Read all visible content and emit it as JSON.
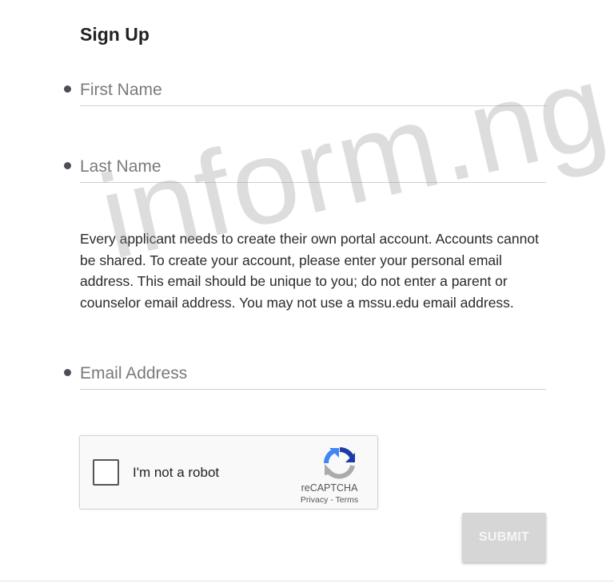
{
  "form": {
    "title": "Sign Up",
    "first_name_placeholder": "First Name",
    "last_name_placeholder": "Last Name",
    "info_text": "Every applicant needs to create their own portal account. Accounts cannot be shared. To create your account, please enter your personal email address. This email should be unique to you; do not enter a parent or counselor email address. You may not use a mssu.edu email address.",
    "email_placeholder": "Email Address",
    "submit_label": "SUBMIT"
  },
  "recaptcha": {
    "label": "I'm not a robot",
    "brand": "reCAPTCHA",
    "privacy_label": "Privacy",
    "separator": " - ",
    "terms_label": "Terms",
    "checked": false
  },
  "watermark": {
    "text": "inform.ng"
  },
  "colors": {
    "submit_bg": "#d6d6d6",
    "bullet": "#4a4f57",
    "recaptcha_blue": "#1c3aa9",
    "recaptcha_lightblue": "#4285f4",
    "recaptcha_gray": "#ababab"
  }
}
